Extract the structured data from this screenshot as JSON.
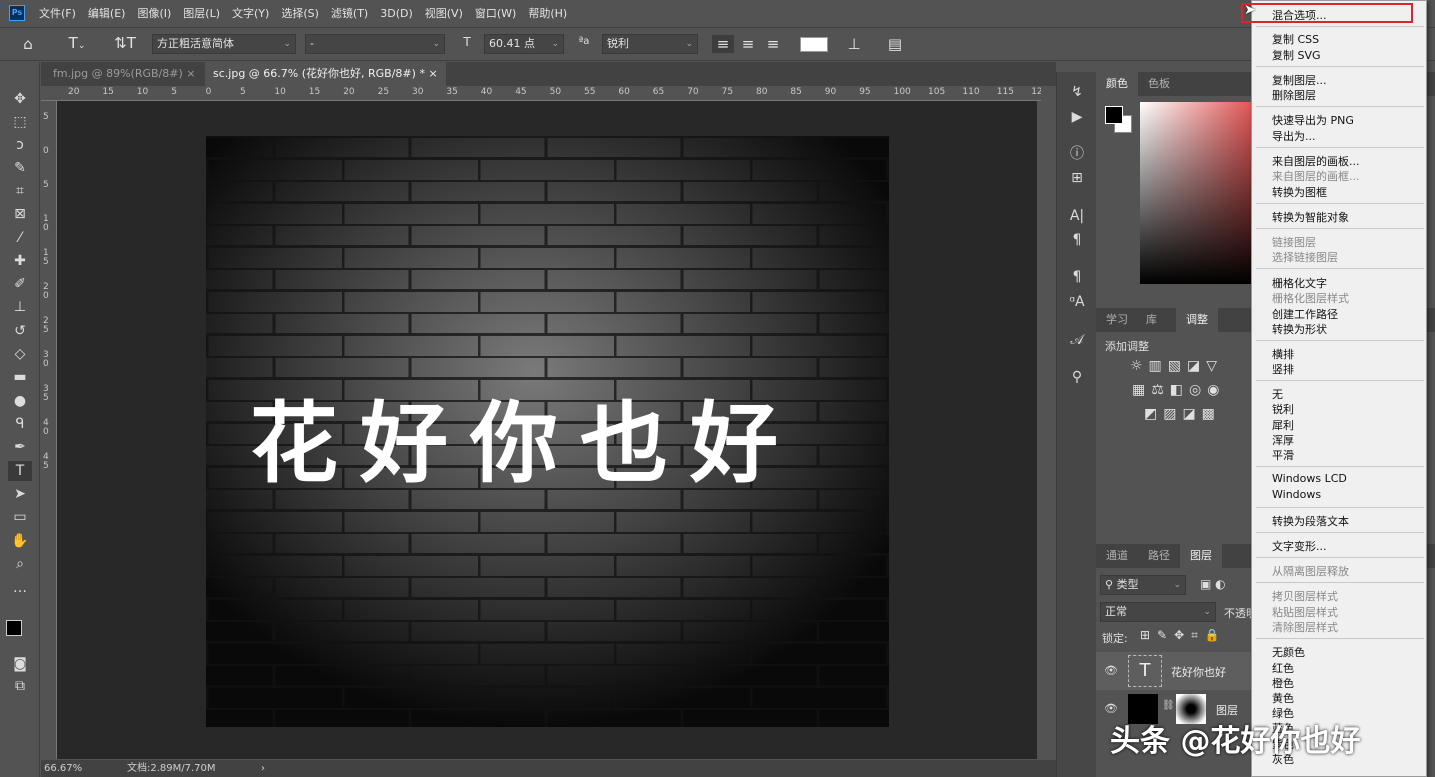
{
  "app": {
    "logo": "Ps"
  },
  "menubar": [
    "文件(F)",
    "编辑(E)",
    "图像(I)",
    "图层(L)",
    "文字(Y)",
    "选择(S)",
    "滤镜(T)",
    "3D(D)",
    "视图(V)",
    "窗口(W)",
    "帮助(H)"
  ],
  "options": {
    "font_family": "方正粗活意简体",
    "font_style": "-",
    "font_size": "60.41 点",
    "aa_label": "ªa",
    "aa_mode": "锐利"
  },
  "tabs": [
    {
      "label": "fm.jpg @ 89%(RGB/8#)",
      "close": "×"
    },
    {
      "label": "sc.jpg @ 66.7% (花好你也好, RGB/8#) *",
      "close": "×"
    }
  ],
  "ruler_top": [
    "20",
    "15",
    "10",
    "5",
    "0",
    "5",
    "10",
    "15",
    "20",
    "25",
    "30",
    "35",
    "40",
    "45",
    "50",
    "55",
    "60",
    "65",
    "70",
    "75",
    "80",
    "85",
    "90",
    "95",
    "100",
    "105",
    "110",
    "115",
    "12"
  ],
  "ruler_left": [
    "5",
    "0",
    "5",
    "1 0",
    "1 5",
    "2 0",
    "2 5",
    "3 0",
    "3 5",
    "4 0",
    "4 5"
  ],
  "canvas": {
    "text": "花好你也好"
  },
  "status": {
    "zoom": "66.67%",
    "doc": "文档:2.89M/7.70M",
    "arrow": "›"
  },
  "panels": {
    "color_tabs": [
      "颜色",
      "色板"
    ],
    "learn_tabs": [
      "学习",
      "库",
      "调整"
    ],
    "adjust_title": "添加调整",
    "layers_tabs": [
      "通道",
      "路径",
      "图层"
    ],
    "filter": "类型",
    "blend": "正常",
    "opacity": "不透明",
    "lock": "锁定:",
    "layers": [
      {
        "name": "花好你也好",
        "kind": "text"
      },
      {
        "name": "图层",
        "kind": "masked"
      }
    ]
  },
  "context_menu": [
    {
      "label": "混合选项...",
      "enabled": true,
      "highlighted": true
    },
    {
      "label": "复制 CSS",
      "enabled": true
    },
    {
      "label": "复制 SVG",
      "enabled": true
    },
    {
      "label": "复制图层...",
      "enabled": true
    },
    {
      "label": "删除图层",
      "enabled": true
    },
    {
      "label": "快速导出为 PNG",
      "enabled": true
    },
    {
      "label": "导出为...",
      "enabled": true
    },
    {
      "label": "来自图层的画板...",
      "enabled": true
    },
    {
      "label": "来自图层的画框...",
      "enabled": false
    },
    {
      "label": "转换为图框",
      "enabled": true
    },
    {
      "label": "转换为智能对象",
      "enabled": true
    },
    {
      "label": "链接图层",
      "enabled": false
    },
    {
      "label": "选择链接图层",
      "enabled": false
    },
    {
      "label": "栅格化文字",
      "enabled": true
    },
    {
      "label": "栅格化图层样式",
      "enabled": false
    },
    {
      "label": "创建工作路径",
      "enabled": true
    },
    {
      "label": "转换为形状",
      "enabled": true
    },
    {
      "label": "横排",
      "enabled": true
    },
    {
      "label": "竖排",
      "enabled": true
    },
    {
      "label": "无",
      "enabled": true
    },
    {
      "label": "锐利",
      "enabled": true
    },
    {
      "label": "犀利",
      "enabled": true
    },
    {
      "label": "浑厚",
      "enabled": true
    },
    {
      "label": "平滑",
      "enabled": true
    },
    {
      "label": "Windows LCD",
      "enabled": true
    },
    {
      "label": "Windows",
      "enabled": true
    },
    {
      "label": "转换为段落文本",
      "enabled": true
    },
    {
      "label": "文字变形...",
      "enabled": true
    },
    {
      "label": "从隔离图层释放",
      "enabled": false
    },
    {
      "label": "拷贝图层样式",
      "enabled": false
    },
    {
      "label": "粘贴图层样式",
      "enabled": false
    },
    {
      "label": "清除图层样式",
      "enabled": false
    },
    {
      "label": "无颜色",
      "enabled": true
    },
    {
      "label": "红色",
      "enabled": true
    },
    {
      "label": "橙色",
      "enabled": true
    },
    {
      "label": "黄色",
      "enabled": true
    },
    {
      "label": "绿色",
      "enabled": true
    },
    {
      "label": "蓝色",
      "enabled": true
    },
    {
      "label": "紫色",
      "enabled": true
    },
    {
      "label": "灰色",
      "enabled": true
    }
  ],
  "watermark": "头条 @花好你也好",
  "colors": {
    "highlight_border": "#d9262c",
    "ui_bg": "#535353",
    "canvas_bg": "#282828"
  }
}
